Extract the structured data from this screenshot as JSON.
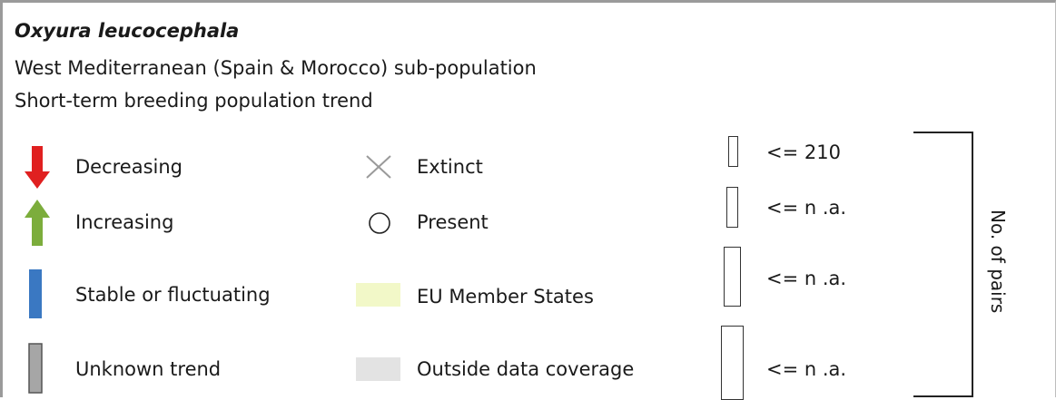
{
  "title": {
    "species": "Oxyura leucocephala",
    "population": "West Mediterranean (Spain & Morocco) sub-population",
    "trend_type": "Short-term breeding population trend"
  },
  "legend": {
    "trends": [
      {
        "label": "Decreasing",
        "icon": "arrow-down-icon",
        "color": "#e02020"
      },
      {
        "label": "Increasing",
        "icon": "arrow-up-icon",
        "color": "#7cad3c"
      },
      {
        "label": "Stable or fluctuating",
        "icon": "bar-icon",
        "color": "#3a78c2"
      },
      {
        "label": "Unknown trend",
        "icon": "bar-icon",
        "color": "#a6a6a6"
      }
    ],
    "status": [
      {
        "label": "Extinct",
        "icon": "cross-icon"
      },
      {
        "label": "Present",
        "icon": "circle-icon"
      },
      {
        "label": "EU Member States",
        "icon": "swatch",
        "color": "#f2f8c8"
      },
      {
        "label": "Outside data coverage",
        "icon": "swatch",
        "color": "#e3e3e3"
      }
    ],
    "sizes": [
      {
        "label": "<= 210"
      },
      {
        "label": "<= n .a."
      },
      {
        "label": "<= n .a."
      },
      {
        "label": "<= n .a."
      }
    ],
    "sizes_axis_label": "No. of pairs"
  }
}
